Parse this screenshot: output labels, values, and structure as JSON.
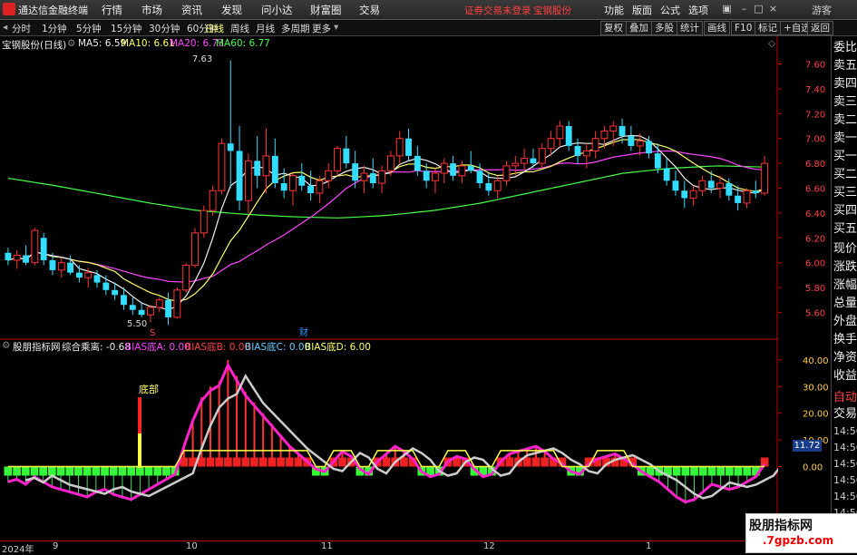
{
  "app": {
    "title": "通达信金融终端"
  },
  "menu": [
    "行情",
    "市场",
    "资讯",
    "发现",
    "问小达",
    "财富圈",
    "交易"
  ],
  "notice": {
    "text": "证券交易未登录",
    "stock": "宝钢股份"
  },
  "right_menu": [
    "功能",
    "版面",
    "公式",
    "选项"
  ],
  "user": "游客",
  "periods": [
    "分时",
    "1分钟",
    "5分钟",
    "15分钟",
    "30分钟",
    "60分钟",
    "日线",
    "周线",
    "月线",
    "多周期",
    "更多"
  ],
  "active_period": "日线",
  "tools": [
    "复权",
    "叠加",
    "多股",
    "统计",
    "画线",
    "F10",
    "标记",
    "+自选",
    "返回"
  ],
  "stock": {
    "name": "宝钢股份(日线)"
  },
  "ma": {
    "ma5": "MA5: 6.59",
    "ma10": "MA10: 6.61",
    "ma20": "MA20: 6.73",
    "ma60": "MA60: 6.77"
  },
  "indicator": {
    "name": "股朋指标网",
    "total": "综合乘离: -0.68",
    "a": "BIAS底A: 0.00",
    "b": "BIAS底B: 0.00",
    "c": "BIAS底C: 0.00",
    "d": "BIAS底D: 6.00",
    "label_bottom": "底部",
    "current": "11.72"
  },
  "annotations": {
    "high": "7.63",
    "low": "5.50",
    "marker_s": "S",
    "marker_cai": "财"
  },
  "chart_data": [
    {
      "type": "candlestick",
      "title": "宝钢股份(日线)",
      "ylim": [
        5.45,
        7.75
      ],
      "yticks": [
        "7.60",
        "7.40",
        "7.20",
        "7.00",
        "6.80",
        "6.60",
        "6.40",
        "6.20",
        "6.00",
        "5.80",
        "5.60"
      ],
      "x_labels": [
        "2024年",
        "9",
        "10",
        "11",
        "12",
        "1"
      ],
      "ohlc": [
        [
          6.08,
          6.12,
          5.98,
          6.02
        ],
        [
          6.02,
          6.1,
          5.95,
          6.06
        ],
        [
          6.06,
          6.14,
          5.98,
          6.0
        ],
        [
          6.0,
          6.28,
          5.98,
          6.26
        ],
        [
          6.2,
          6.24,
          5.98,
          6.02
        ],
        [
          6.02,
          6.08,
          5.9,
          5.94
        ],
        [
          5.94,
          6.04,
          5.88,
          6.0
        ],
        [
          6.0,
          6.06,
          5.9,
          5.92
        ],
        [
          5.92,
          5.98,
          5.84,
          5.88
        ],
        [
          5.88,
          5.96,
          5.8,
          5.92
        ],
        [
          5.9,
          5.94,
          5.8,
          5.84
        ],
        [
          5.84,
          5.9,
          5.74,
          5.78
        ],
        [
          5.78,
          5.84,
          5.7,
          5.74
        ],
        [
          5.74,
          5.8,
          5.62,
          5.66
        ],
        [
          5.66,
          5.72,
          5.58,
          5.62
        ],
        [
          5.62,
          5.68,
          5.56,
          5.58
        ],
        [
          5.58,
          5.66,
          5.52,
          5.64
        ],
        [
          5.64,
          5.72,
          5.6,
          5.7
        ],
        [
          5.7,
          5.76,
          5.5,
          5.56
        ],
        [
          5.56,
          5.8,
          5.55,
          5.78
        ],
        [
          5.78,
          6.0,
          5.76,
          5.98
        ],
        [
          5.98,
          6.28,
          5.96,
          6.24
        ],
        [
          6.24,
          6.46,
          6.2,
          6.42
        ],
        [
          6.42,
          6.62,
          6.38,
          6.58
        ],
        [
          6.58,
          7.0,
          6.55,
          6.96
        ],
        [
          6.96,
          7.63,
          6.6,
          6.9
        ],
        [
          6.9,
          7.1,
          6.42,
          6.5
        ],
        [
          6.5,
          6.88,
          6.4,
          6.82
        ],
        [
          6.82,
          7.02,
          6.6,
          6.7
        ],
        [
          6.7,
          7.08,
          6.56,
          6.86
        ],
        [
          6.86,
          7.0,
          6.6,
          6.64
        ],
        [
          6.64,
          6.76,
          6.52,
          6.58
        ],
        [
          6.58,
          6.72,
          6.46,
          6.7
        ],
        [
          6.7,
          6.8,
          6.58,
          6.62
        ],
        [
          6.62,
          6.74,
          6.5,
          6.56
        ],
        [
          6.56,
          6.7,
          6.48,
          6.66
        ],
        [
          6.66,
          6.8,
          6.6,
          6.74
        ],
        [
          6.74,
          6.94,
          6.7,
          6.92
        ],
        [
          6.92,
          7.02,
          6.76,
          6.8
        ],
        [
          6.8,
          6.9,
          6.6,
          6.66
        ],
        [
          6.66,
          6.78,
          6.56,
          6.72
        ],
        [
          6.72,
          6.84,
          6.6,
          6.64
        ],
        [
          6.64,
          6.78,
          6.56,
          6.74
        ],
        [
          6.74,
          6.9,
          6.7,
          6.86
        ],
        [
          6.86,
          7.06,
          6.8,
          7.0
        ],
        [
          7.0,
          7.08,
          6.82,
          6.86
        ],
        [
          6.86,
          6.94,
          6.7,
          6.74
        ],
        [
          6.74,
          6.8,
          6.6,
          6.66
        ],
        [
          6.66,
          6.76,
          6.56,
          6.72
        ],
        [
          6.72,
          6.84,
          6.64,
          6.8
        ],
        [
          6.8,
          6.86,
          6.66,
          6.7
        ],
        [
          6.7,
          6.82,
          6.64,
          6.78
        ],
        [
          6.78,
          6.9,
          6.72,
          6.74
        ],
        [
          6.74,
          6.8,
          6.6,
          6.64
        ],
        [
          6.64,
          6.72,
          6.54,
          6.58
        ],
        [
          6.58,
          6.7,
          6.52,
          6.66
        ],
        [
          6.66,
          6.82,
          6.62,
          6.78
        ],
        [
          6.78,
          6.86,
          6.7,
          6.8
        ],
        [
          6.8,
          6.92,
          6.74,
          6.84
        ],
        [
          6.84,
          6.92,
          6.76,
          6.8
        ],
        [
          6.8,
          6.96,
          6.76,
          6.92
        ],
        [
          6.92,
          7.06,
          6.86,
          7.0
        ],
        [
          7.0,
          7.14,
          6.94,
          7.1
        ],
        [
          7.1,
          7.14,
          6.9,
          6.94
        ],
        [
          6.94,
          7.0,
          6.8,
          6.86
        ],
        [
          6.86,
          6.96,
          6.76,
          6.9
        ],
        [
          6.9,
          7.06,
          6.84,
          7.0
        ],
        [
          7.0,
          7.1,
          6.92,
          7.06
        ],
        [
          7.06,
          7.14,
          6.94,
          7.1
        ],
        [
          7.1,
          7.16,
          6.96,
          7.02
        ],
        [
          7.02,
          7.1,
          6.9,
          6.94
        ],
        [
          6.94,
          7.04,
          6.86,
          6.98
        ],
        [
          6.98,
          7.02,
          6.84,
          6.88
        ],
        [
          6.88,
          6.96,
          6.72,
          6.76
        ],
        [
          6.76,
          6.84,
          6.62,
          6.66
        ],
        [
          6.66,
          6.74,
          6.54,
          6.58
        ],
        [
          6.58,
          6.66,
          6.44,
          6.52
        ],
        [
          6.52,
          6.62,
          6.46,
          6.58
        ],
        [
          6.58,
          6.7,
          6.54,
          6.66
        ],
        [
          6.66,
          6.74,
          6.56,
          6.6
        ],
        [
          6.6,
          6.7,
          6.52,
          6.64
        ],
        [
          6.64,
          6.68,
          6.5,
          6.54
        ],
        [
          6.54,
          6.62,
          6.42,
          6.48
        ],
        [
          6.48,
          6.6,
          6.44,
          6.58
        ],
        [
          6.58,
          6.66,
          6.52,
          6.56
        ],
        [
          6.56,
          6.86,
          6.54,
          6.8
        ]
      ]
    },
    {
      "type": "bar",
      "title": "股朋指标网",
      "ylim": [
        -25,
        42
      ],
      "yticks": [
        "40.00",
        "30.00",
        "20.00",
        "10.00",
        "0.00"
      ]
    }
  ]
}
